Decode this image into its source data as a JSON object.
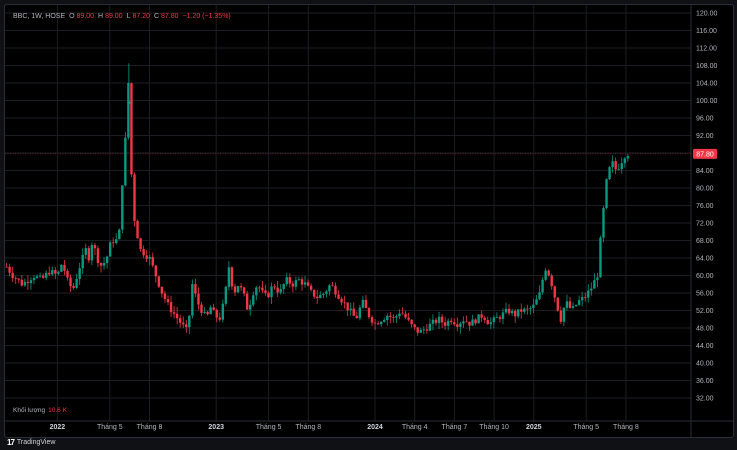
{
  "header": {
    "symbol": "BBC, 1W, HOSE",
    "open_label": "O",
    "open": "89.00",
    "high_label": "H",
    "high": "89.00",
    "low_label": "L",
    "low": "87.20",
    "close_label": "C",
    "close": "87.80",
    "change": "−1.20 (−1.35%)"
  },
  "volume": {
    "label": "Khối lượng",
    "value": "10.6 K"
  },
  "brand": {
    "name": "TradingView",
    "logo": "17"
  },
  "colors": {
    "up": "#089981",
    "down": "#f23645",
    "background": "#000000",
    "grid": "#1c1e24",
    "text": "#b2b5be"
  },
  "chart_data": {
    "type": "candlestick",
    "y_ticks": [
      "32.00",
      "36.00",
      "40.00",
      "44.00",
      "48.00",
      "52.00",
      "56.00",
      "60.00",
      "64.00",
      "68.00",
      "72.00",
      "76.00",
      "80.00",
      "84.00",
      "88.00",
      "92.00",
      "96.00",
      "100.00",
      "104.00",
      "108.00",
      "112.00",
      "116.00",
      "120.00"
    ],
    "ylim": [
      30,
      121
    ],
    "last_price": "87.80",
    "x_labels": [
      {
        "label": "2022",
        "year": 2022.0,
        "bold": true
      },
      {
        "label": "Tháng 5",
        "year": 2022.33,
        "bold": false
      },
      {
        "label": "Tháng 8",
        "year": 2022.58,
        "bold": false
      },
      {
        "label": "2023",
        "year": 2023.0,
        "bold": true
      },
      {
        "label": "Tháng 5",
        "year": 2023.33,
        "bold": false
      },
      {
        "label": "Tháng 8",
        "year": 2023.58,
        "bold": false
      },
      {
        "label": "2024",
        "year": 2024.0,
        "bold": true
      },
      {
        "label": "Tháng 4",
        "year": 2024.25,
        "bold": false
      },
      {
        "label": "Tháng 7",
        "year": 2024.5,
        "bold": false
      },
      {
        "label": "Tháng 10",
        "year": 2024.75,
        "bold": false
      },
      {
        "label": "2025",
        "year": 2025.0,
        "bold": true
      },
      {
        "label": "Tháng 5",
        "year": 2025.33,
        "bold": false
      },
      {
        "label": "Tháng 8",
        "year": 2025.58,
        "bold": false
      }
    ],
    "x_range": [
      2021.67,
      2025.99
    ],
    "close_path": [
      [
        2021.68,
        62
      ],
      [
        2021.72,
        60
      ],
      [
        2021.78,
        58
      ],
      [
        2021.85,
        60
      ],
      [
        2021.9,
        59
      ],
      [
        2021.95,
        61
      ],
      [
        2022.0,
        60
      ],
      [
        2022.03,
        63
      ],
      [
        2022.07,
        58
      ],
      [
        2022.1,
        57
      ],
      [
        2022.14,
        62
      ],
      [
        2022.18,
        66
      ],
      [
        2022.2,
        64
      ],
      [
        2022.22,
        68
      ],
      [
        2022.25,
        64
      ],
      [
        2022.28,
        62
      ],
      [
        2022.31,
        64
      ],
      [
        2022.34,
        68
      ],
      [
        2022.37,
        68
      ],
      [
        2022.39,
        70
      ],
      [
        2022.41,
        82
      ],
      [
        2022.43,
        92
      ],
      [
        2022.45,
        106
      ],
      [
        2022.465,
        84
      ],
      [
        2022.48,
        74
      ],
      [
        2022.5,
        70
      ],
      [
        2022.52,
        66
      ],
      [
        2022.55,
        65
      ],
      [
        2022.58,
        64
      ],
      [
        2022.62,
        60
      ],
      [
        2022.66,
        56
      ],
      [
        2022.7,
        53
      ],
      [
        2022.74,
        51
      ],
      [
        2022.78,
        49
      ],
      [
        2022.82,
        47
      ],
      [
        2022.85,
        58
      ],
      [
        2022.88,
        54
      ],
      [
        2022.91,
        52
      ],
      [
        2022.94,
        50
      ],
      [
        2022.96,
        53
      ],
      [
        2022.99,
        51
      ],
      [
        2023.02,
        50
      ],
      [
        2023.05,
        54
      ],
      [
        2023.08,
        62
      ],
      [
        2023.11,
        56
      ],
      [
        2023.14,
        58
      ],
      [
        2023.17,
        56
      ],
      [
        2023.2,
        52
      ],
      [
        2023.23,
        56
      ],
      [
        2023.26,
        58
      ],
      [
        2023.29,
        56
      ],
      [
        2023.32,
        55
      ],
      [
        2023.36,
        58
      ],
      [
        2023.4,
        56
      ],
      [
        2023.44,
        59
      ],
      [
        2023.48,
        58
      ],
      [
        2023.52,
        59
      ],
      [
        2023.56,
        58
      ],
      [
        2023.6,
        56
      ],
      [
        2023.64,
        55
      ],
      [
        2023.68,
        56
      ],
      [
        2023.72,
        58
      ],
      [
        2023.76,
        56
      ],
      [
        2023.8,
        54
      ],
      [
        2023.84,
        52
      ],
      [
        2023.88,
        50
      ],
      [
        2023.92,
        54
      ],
      [
        2023.96,
        51
      ],
      [
        2024.0,
        49
      ],
      [
        2024.04,
        50
      ],
      [
        2024.08,
        51
      ],
      [
        2024.12,
        50
      ],
      [
        2024.16,
        52
      ],
      [
        2024.2,
        50
      ],
      [
        2024.24,
        48
      ],
      [
        2024.28,
        47
      ],
      [
        2024.32,
        48
      ],
      [
        2024.36,
        49
      ],
      [
        2024.4,
        50
      ],
      [
        2024.44,
        49
      ],
      [
        2024.48,
        50
      ],
      [
        2024.52,
        49
      ],
      [
        2024.56,
        50
      ],
      [
        2024.6,
        49
      ],
      [
        2024.64,
        50
      ],
      [
        2024.68,
        51
      ],
      [
        2024.72,
        49
      ],
      [
        2024.76,
        50
      ],
      [
        2024.8,
        51
      ],
      [
        2024.84,
        52
      ],
      [
        2024.88,
        51
      ],
      [
        2024.92,
        52
      ],
      [
        2024.96,
        52
      ],
      [
        2025.0,
        53
      ],
      [
        2025.04,
        56
      ],
      [
        2025.07,
        62
      ],
      [
        2025.1,
        60
      ],
      [
        2025.14,
        54
      ],
      [
        2025.17,
        50
      ],
      [
        2025.2,
        54
      ],
      [
        2025.24,
        52
      ],
      [
        2025.28,
        54
      ],
      [
        2025.32,
        55
      ],
      [
        2025.36,
        57
      ],
      [
        2025.4,
        60
      ],
      [
        2025.43,
        72
      ],
      [
        2025.46,
        82
      ],
      [
        2025.49,
        86
      ],
      [
        2025.52,
        84
      ],
      [
        2025.55,
        86
      ],
      [
        2025.58,
        88
      ],
      [
        2025.6,
        87.8
      ]
    ]
  }
}
